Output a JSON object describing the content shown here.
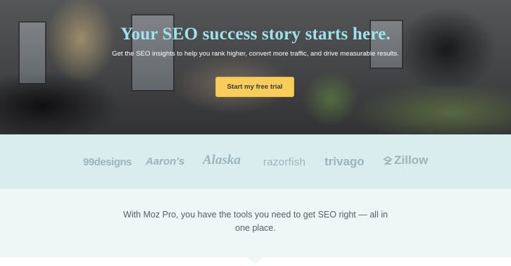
{
  "hero": {
    "title": "Your SEO success story starts here.",
    "subtitle": "Get the SEO insights to help you rank higher, convert more traffic, and drive measurable results.",
    "cta_label": "Start my free trial",
    "title_color": "#9fe2ec",
    "cta_color": "#f9cd5b"
  },
  "logos": {
    "items": [
      "99designs",
      "Aaron's",
      "Alaska",
      "razorfish",
      "trivago",
      "Zillow"
    ],
    "color": "#9bb5bc",
    "background": "#d9ecee"
  },
  "pitch": {
    "text": "With Moz Pro, you have the tools you need to get SEO right — all in one place.",
    "background": "#eef6f6"
  }
}
